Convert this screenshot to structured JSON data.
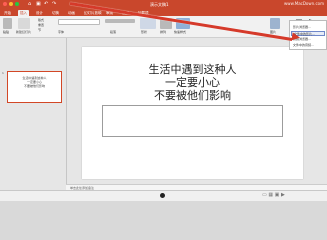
{
  "window": {
    "title": "演示文稿1",
    "watermark": "www.MacDown.com"
  },
  "tabs": [
    {
      "label": "开始"
    },
    {
      "label": "插入"
    },
    {
      "label": "设计"
    },
    {
      "label": "切换"
    },
    {
      "label": "动画"
    },
    {
      "label": "幻灯片放映"
    },
    {
      "label": "审阅"
    },
    {
      "label": "视图"
    },
    {
      "label": "加载项"
    }
  ],
  "ribbon": {
    "items": [
      "粘贴",
      "新建幻灯片",
      "版式",
      "重置",
      "节",
      "字体",
      "段落",
      "形状",
      "排列",
      "快速样式",
      "图片",
      "媒体"
    ]
  },
  "thumbnail": {
    "number": "1",
    "lines": [
      "生活中遇到这种人",
      "一定要小心",
      "不要被他们影响"
    ]
  },
  "slide": {
    "lines": [
      "生活中遇到这种人",
      "一定要小心",
      "不要被他们影响"
    ]
  },
  "notes": {
    "placeholder": "单击此处添加备注"
  },
  "dropdown": {
    "items": [
      "影片浏览器...",
      "文件中的影片...",
      "音频浏览器...",
      "文件中的音频..."
    ],
    "selected_index": 1
  },
  "colors": {
    "accent": "#c9472c",
    "arrow": "#d53a2a"
  }
}
